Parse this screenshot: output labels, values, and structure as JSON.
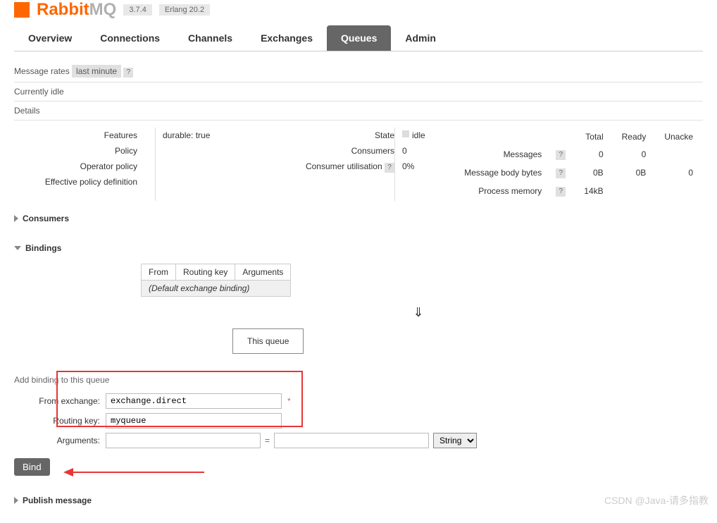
{
  "header": {
    "brand_a": "Rabbit",
    "brand_b": "MQ",
    "version": "3.7.4",
    "erlang": "Erlang 20.2"
  },
  "tabs": {
    "overview": "Overview",
    "connections": "Connections",
    "channels": "Channels",
    "exchanges": "Exchanges",
    "queues": "Queues",
    "admin": "Admin"
  },
  "rates": {
    "label": "Message rates",
    "period": "last minute",
    "help": "?"
  },
  "status": {
    "idle": "Currently idle",
    "details": "Details"
  },
  "details_left": {
    "features_label": "Features",
    "features_value": "durable: true",
    "policy_label": "Policy",
    "operator_policy_label": "Operator policy",
    "effective_policy_label": "Effective policy definition"
  },
  "details_mid": {
    "state_label": "State",
    "state_value": "idle",
    "consumers_label": "Consumers",
    "consumers_value": "0",
    "utilisation_label": "Consumer utilisation",
    "utilisation_value": "0%"
  },
  "stats": {
    "col_total": "Total",
    "col_ready": "Ready",
    "col_unacked": "Unacke",
    "messages_label": "Messages",
    "messages_total": "0",
    "messages_ready": "0",
    "body_label": "Message body bytes",
    "body_total": "0B",
    "body_ready": "0B",
    "body_unacked": "0",
    "memory_label": "Process memory",
    "memory_total": "14kB"
  },
  "sections": {
    "consumers": "Consumers",
    "bindings": "Bindings",
    "publish": "Publish message"
  },
  "bindings": {
    "col_from": "From",
    "col_routing": "Routing key",
    "col_args": "Arguments",
    "default_row": "(Default exchange binding)",
    "arrow": "⇓",
    "this_queue": "This queue"
  },
  "add_binding": {
    "title": "Add binding to this queue",
    "from_exchange_label": "From exchange:",
    "from_exchange_value": "exchange.direct",
    "routing_key_label": "Routing key:",
    "routing_key_value": "myqueue",
    "arguments_label": "Arguments:",
    "equals": "=",
    "type_option": "String",
    "bind_button": "Bind"
  },
  "watermark": "CSDN @Java-请多指教"
}
